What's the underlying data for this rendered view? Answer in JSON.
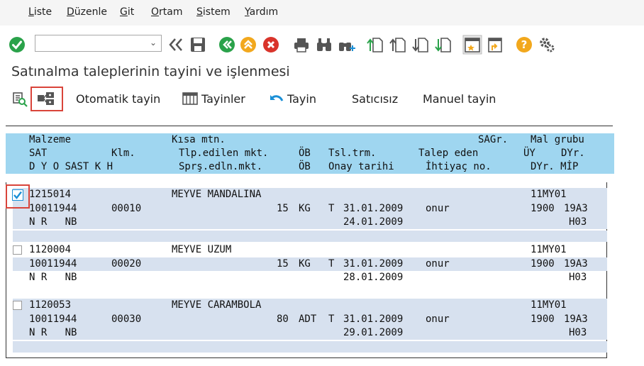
{
  "menu": [
    "Liste",
    "Düzenle",
    "Git",
    "Ortam",
    "Sistem",
    "Yardım"
  ],
  "toolbar": {
    "command_value": "",
    "icons": [
      "check-icon",
      "double-left-icon",
      "save-icon",
      "back-icon",
      "exit-icon",
      "cancel-icon",
      "print-icon",
      "find-icon",
      "find-next-icon",
      "first-page-icon",
      "prev-page-icon",
      "next-page-icon",
      "last-page-icon",
      "new-session-icon",
      "shortcut-icon",
      "help-icon",
      "settings-icon"
    ]
  },
  "title": "Satınalma taleplerinin tayini ve işlenmesi",
  "app_toolbar": {
    "auto_assign": "Otomatik tayin",
    "assignments": "Tayinler",
    "assign": "Tayin",
    "no_vendor": "Satıcısız",
    "manual_assign": "Manuel tayin"
  },
  "header": {
    "row1": {
      "c1": "Malzeme",
      "c2": "Kısa mtn.",
      "c3": "SAGr.",
      "c4": "Mal grubu"
    },
    "row2": {
      "c1": "SAT",
      "c2": "Klm.",
      "c3": "Tlp.edilen mkt.",
      "c4": "ÖB",
      "c5": "Tsl.trm.",
      "c6": "Talep eden",
      "c7": "ÜY",
      "c8": "DYr."
    },
    "row3": {
      "c1": "D Y O SAST K H",
      "c3": "Sprş.edln.mkt.",
      "c4": "ÖB",
      "c5": "Onay tarihi",
      "c6": "İhtiyaç no.",
      "c7": "DYr. MİP"
    }
  },
  "items": [
    {
      "material": "1215014",
      "desc": "MEYVE MANDALINA",
      "matgroup": "11MY01",
      "sat": "10011944",
      "item": "00010",
      "qty": "15",
      "unit": "KG",
      "t": "T",
      "date": "31.01.2009",
      "req": "onur",
      "plant": "1900",
      "stor": "19A3",
      "flags": "N R   NB",
      "approve": "24.01.2009",
      "mrp": "H03",
      "checked": true
    },
    {
      "material": "1120004",
      "desc": "MEYVE UZUM",
      "matgroup": "11MY01",
      "sat": "10011944",
      "item": "00020",
      "qty": "15",
      "unit": "KG",
      "t": "T",
      "date": "31.01.2009",
      "req": "onur",
      "plant": "1900",
      "stor": "19A3",
      "flags": "N R   NB",
      "approve": "28.01.2009",
      "mrp": "H03",
      "checked": false
    },
    {
      "material": "1120053",
      "desc": "MEYVE CARAMBOLA",
      "matgroup": "11MY01",
      "sat": "10011944",
      "item": "00030",
      "qty": "80",
      "unit": "ADT",
      "t": "T",
      "date": "31.01.2009",
      "req": "onur",
      "plant": "1900",
      "stor": "19A3",
      "flags": "N R   NB",
      "approve": "29.01.2009",
      "mrp": "H03",
      "checked": false
    }
  ],
  "colors": {
    "header_bg": "#9fd6f0",
    "row_band": "#d7e1ef",
    "highlight": "#d9443a",
    "ok_green": "#2aa24a",
    "warn_orange": "#f2a81d",
    "cancel_red": "#d9342b"
  }
}
